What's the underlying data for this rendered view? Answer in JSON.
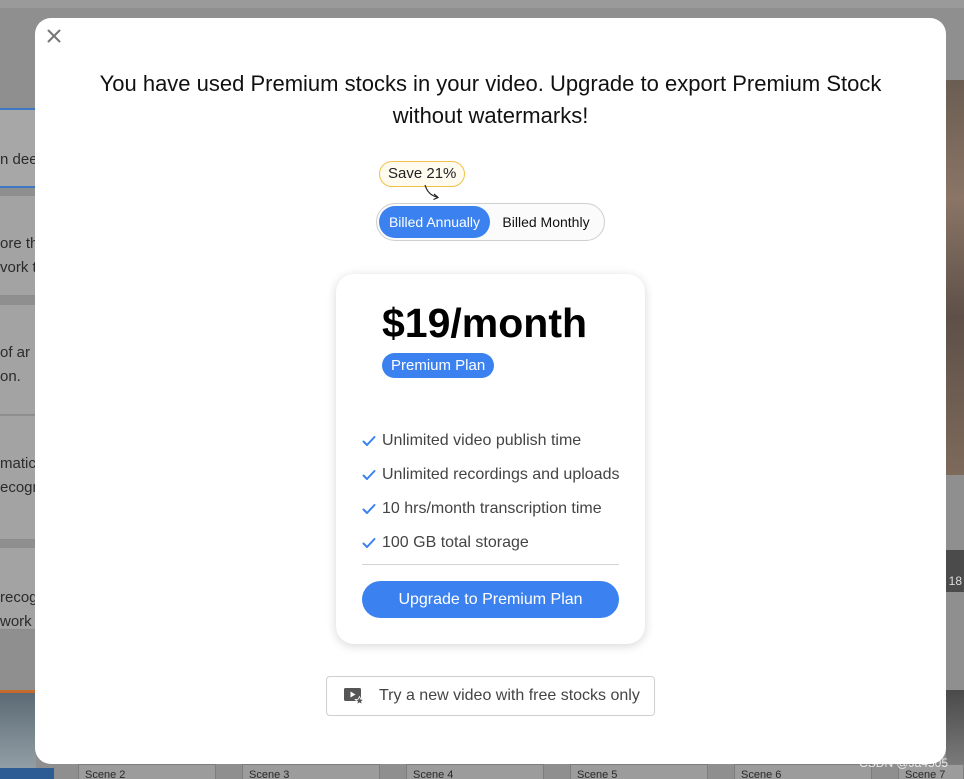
{
  "background": {
    "left_cards": [
      {
        "lines": [
          "n dee"
        ],
        "active": true
      },
      {
        "lines": [
          "ore th",
          "vork to"
        ],
        "active": false
      },
      {
        "lines": [
          "of ar",
          "on."
        ],
        "active": false
      },
      {
        "lines": [
          "matica",
          "ecogn"
        ],
        "active": false
      },
      {
        "lines": [
          "recog",
          "work"
        ],
        "active": false
      }
    ],
    "right_strip_label": "18",
    "scenes": [
      "Scene 2",
      "Scene 3",
      "Scene 4",
      "Scene 5",
      "Scene 6",
      "Scene 7"
    ],
    "watermark": "CSDN @Ja4505"
  },
  "modal": {
    "close_icon": "close-icon",
    "title": "You have used Premium stocks in your video. Upgrade to export Premium Stock without watermarks!",
    "save_badge": "Save 21%",
    "billing": {
      "annual_label": "Billed Annually",
      "monthly_label": "Billed Monthly",
      "selected": "annual"
    },
    "plan": {
      "price": "$19/month",
      "name": "Premium Plan",
      "features": [
        "Unlimited video publish time",
        "Unlimited recordings and uploads",
        "10 hrs/month transcription time",
        "100 GB total storage"
      ],
      "cta": "Upgrade to Premium Plan"
    },
    "free_option": {
      "icon": "video-star-icon",
      "label": "Try a new video with free stocks only"
    },
    "colors": {
      "accent": "#3b82f0",
      "badge_border": "#f1c04a"
    }
  }
}
